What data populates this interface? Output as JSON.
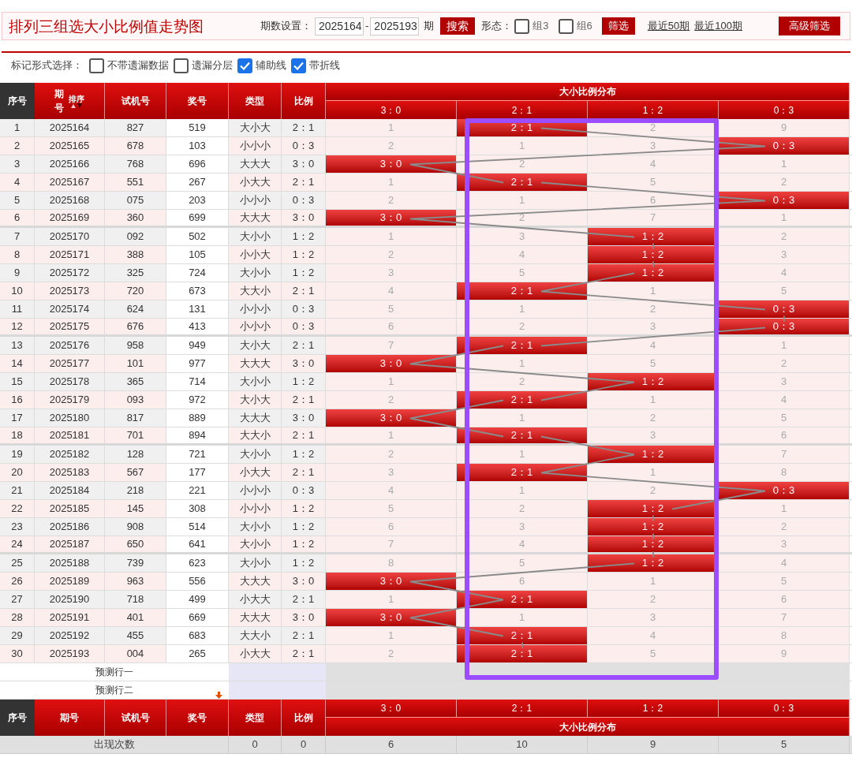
{
  "title": "排列三组选大小比例值走势图",
  "filter": {
    "period_label": "期数设置：",
    "start": "2025164",
    "dash": "-",
    "end": "2025193",
    "period_unit": "期",
    "search_button": "搜索",
    "form_label": "形态：",
    "forms": [
      {
        "label": "组3",
        "checked": false
      },
      {
        "label": "组6",
        "checked": false
      }
    ],
    "filter_button": "筛选",
    "links": [
      "最近50期",
      "最近100期"
    ],
    "advanced_button": "高级筛选"
  },
  "mark_options": {
    "label": "标记形式选择：",
    "options": [
      {
        "label": "不带遗漏数据",
        "checked": false
      },
      {
        "label": "遗漏分层",
        "checked": false
      },
      {
        "label": "辅助线",
        "checked": true
      },
      {
        "label": "带折线",
        "checked": true
      }
    ]
  },
  "table": {
    "columns": [
      "序号",
      "期号",
      "试机号",
      "奖号",
      "类型",
      "比例"
    ],
    "sort_label": "排序",
    "group_header": "大小比例分布",
    "sub_columns": [
      "3：0",
      "2：1",
      "1：2",
      "0：3"
    ],
    "rows": [
      {
        "no": "1",
        "issue": "2025164",
        "test": "827",
        "draw": "519",
        "type": "大小大",
        "ratio": "2：1",
        "dist": [
          {
            "text": "1",
            "hit": false
          },
          {
            "text": "2：1",
            "hit": true
          },
          {
            "text": "2",
            "hit": false
          },
          {
            "text": "9",
            "hit": false
          }
        ]
      },
      {
        "no": "2",
        "issue": "2025165",
        "test": "678",
        "draw": "103",
        "type": "小小小",
        "ratio": "0：3",
        "dist": [
          {
            "text": "2",
            "hit": false
          },
          {
            "text": "1",
            "hit": false
          },
          {
            "text": "3",
            "hit": false
          },
          {
            "text": "0：3",
            "hit": true
          }
        ]
      },
      {
        "no": "3",
        "issue": "2025166",
        "test": "768",
        "draw": "696",
        "type": "大大大",
        "ratio": "3：0",
        "dist": [
          {
            "text": "3：0",
            "hit": true
          },
          {
            "text": "2",
            "hit": false
          },
          {
            "text": "4",
            "hit": false
          },
          {
            "text": "1",
            "hit": false
          }
        ]
      },
      {
        "no": "4",
        "issue": "2025167",
        "test": "551",
        "draw": "267",
        "type": "小大大",
        "ratio": "2：1",
        "dist": [
          {
            "text": "1",
            "hit": false
          },
          {
            "text": "2：1",
            "hit": true
          },
          {
            "text": "5",
            "hit": false
          },
          {
            "text": "2",
            "hit": false
          }
        ]
      },
      {
        "no": "5",
        "issue": "2025168",
        "test": "075",
        "draw": "203",
        "type": "小小小",
        "ratio": "0：3",
        "dist": [
          {
            "text": "2",
            "hit": false
          },
          {
            "text": "1",
            "hit": false
          },
          {
            "text": "6",
            "hit": false
          },
          {
            "text": "0：3",
            "hit": true
          }
        ]
      },
      {
        "no": "6",
        "issue": "2025169",
        "test": "360",
        "draw": "699",
        "type": "大大大",
        "ratio": "3：0",
        "dist": [
          {
            "text": "3：0",
            "hit": true
          },
          {
            "text": "2",
            "hit": false
          },
          {
            "text": "7",
            "hit": false
          },
          {
            "text": "1",
            "hit": false
          }
        ]
      },
      {
        "no": "7",
        "issue": "2025170",
        "test": "092",
        "draw": "502",
        "type": "大小小",
        "ratio": "1：2",
        "dist": [
          {
            "text": "1",
            "hit": false
          },
          {
            "text": "3",
            "hit": false
          },
          {
            "text": "1：2",
            "hit": true
          },
          {
            "text": "2",
            "hit": false
          }
        ]
      },
      {
        "no": "8",
        "issue": "2025171",
        "test": "388",
        "draw": "105",
        "type": "小小大",
        "ratio": "1：2",
        "dist": [
          {
            "text": "2",
            "hit": false
          },
          {
            "text": "4",
            "hit": false
          },
          {
            "text": "1：2",
            "hit": true
          },
          {
            "text": "3",
            "hit": false
          }
        ]
      },
      {
        "no": "9",
        "issue": "2025172",
        "test": "325",
        "draw": "724",
        "type": "大小小",
        "ratio": "1：2",
        "dist": [
          {
            "text": "3",
            "hit": false
          },
          {
            "text": "5",
            "hit": false
          },
          {
            "text": "1：2",
            "hit": true
          },
          {
            "text": "4",
            "hit": false
          }
        ]
      },
      {
        "no": "10",
        "issue": "2025173",
        "test": "720",
        "draw": "673",
        "type": "大大小",
        "ratio": "2：1",
        "dist": [
          {
            "text": "4",
            "hit": false
          },
          {
            "text": "2：1",
            "hit": true
          },
          {
            "text": "1",
            "hit": false
          },
          {
            "text": "5",
            "hit": false
          }
        ]
      },
      {
        "no": "11",
        "issue": "2025174",
        "test": "624",
        "draw": "131",
        "type": "小小小",
        "ratio": "0：3",
        "dist": [
          {
            "text": "5",
            "hit": false
          },
          {
            "text": "1",
            "hit": false
          },
          {
            "text": "2",
            "hit": false
          },
          {
            "text": "0：3",
            "hit": true
          }
        ]
      },
      {
        "no": "12",
        "issue": "2025175",
        "test": "676",
        "draw": "413",
        "type": "小小小",
        "ratio": "0：3",
        "dist": [
          {
            "text": "6",
            "hit": false
          },
          {
            "text": "2",
            "hit": false
          },
          {
            "text": "3",
            "hit": false
          },
          {
            "text": "0：3",
            "hit": true
          }
        ]
      },
      {
        "no": "13",
        "issue": "2025176",
        "test": "958",
        "draw": "949",
        "type": "大小大",
        "ratio": "2：1",
        "dist": [
          {
            "text": "7",
            "hit": false
          },
          {
            "text": "2：1",
            "hit": true
          },
          {
            "text": "4",
            "hit": false
          },
          {
            "text": "1",
            "hit": false
          }
        ]
      },
      {
        "no": "14",
        "issue": "2025177",
        "test": "101",
        "draw": "977",
        "type": "大大大",
        "ratio": "3：0",
        "dist": [
          {
            "text": "3：0",
            "hit": true
          },
          {
            "text": "1",
            "hit": false
          },
          {
            "text": "5",
            "hit": false
          },
          {
            "text": "2",
            "hit": false
          }
        ]
      },
      {
        "no": "15",
        "issue": "2025178",
        "test": "365",
        "draw": "714",
        "type": "大小小",
        "ratio": "1：2",
        "dist": [
          {
            "text": "1",
            "hit": false
          },
          {
            "text": "2",
            "hit": false
          },
          {
            "text": "1：2",
            "hit": true
          },
          {
            "text": "3",
            "hit": false
          }
        ]
      },
      {
        "no": "16",
        "issue": "2025179",
        "test": "093",
        "draw": "972",
        "type": "大小大",
        "ratio": "2：1",
        "dist": [
          {
            "text": "2",
            "hit": false
          },
          {
            "text": "2：1",
            "hit": true
          },
          {
            "text": "1",
            "hit": false
          },
          {
            "text": "4",
            "hit": false
          }
        ]
      },
      {
        "no": "17",
        "issue": "2025180",
        "test": "817",
        "draw": "889",
        "type": "大大大",
        "ratio": "3：0",
        "dist": [
          {
            "text": "3：0",
            "hit": true
          },
          {
            "text": "1",
            "hit": false
          },
          {
            "text": "2",
            "hit": false
          },
          {
            "text": "5",
            "hit": false
          }
        ]
      },
      {
        "no": "18",
        "issue": "2025181",
        "test": "701",
        "draw": "894",
        "type": "大大小",
        "ratio": "2：1",
        "dist": [
          {
            "text": "1",
            "hit": false
          },
          {
            "text": "2：1",
            "hit": true
          },
          {
            "text": "3",
            "hit": false
          },
          {
            "text": "6",
            "hit": false
          }
        ]
      },
      {
        "no": "19",
        "issue": "2025182",
        "test": "128",
        "draw": "721",
        "type": "大小小",
        "ratio": "1：2",
        "dist": [
          {
            "text": "2",
            "hit": false
          },
          {
            "text": "1",
            "hit": false
          },
          {
            "text": "1：2",
            "hit": true
          },
          {
            "text": "7",
            "hit": false
          }
        ]
      },
      {
        "no": "20",
        "issue": "2025183",
        "test": "567",
        "draw": "177",
        "type": "小大大",
        "ratio": "2：1",
        "dist": [
          {
            "text": "3",
            "hit": false
          },
          {
            "text": "2：1",
            "hit": true
          },
          {
            "text": "1",
            "hit": false
          },
          {
            "text": "8",
            "hit": false
          }
        ]
      },
      {
        "no": "21",
        "issue": "2025184",
        "test": "218",
        "draw": "221",
        "type": "小小小",
        "ratio": "0：3",
        "dist": [
          {
            "text": "4",
            "hit": false
          },
          {
            "text": "1",
            "hit": false
          },
          {
            "text": "2",
            "hit": false
          },
          {
            "text": "0：3",
            "hit": true
          }
        ]
      },
      {
        "no": "22",
        "issue": "2025185",
        "test": "145",
        "draw": "308",
        "type": "小小小",
        "ratio": "1：2",
        "dist": [
          {
            "text": "5",
            "hit": false
          },
          {
            "text": "2",
            "hit": false
          },
          {
            "text": "1：2",
            "hit": true
          },
          {
            "text": "1",
            "hit": false
          }
        ]
      },
      {
        "no": "23",
        "issue": "2025186",
        "test": "908",
        "draw": "514",
        "type": "大小小",
        "ratio": "1：2",
        "dist": [
          {
            "text": "6",
            "hit": false
          },
          {
            "text": "3",
            "hit": false
          },
          {
            "text": "1：2",
            "hit": true
          },
          {
            "text": "2",
            "hit": false
          }
        ]
      },
      {
        "no": "24",
        "issue": "2025187",
        "test": "650",
        "draw": "641",
        "type": "大小小",
        "ratio": "1：2",
        "dist": [
          {
            "text": "7",
            "hit": false
          },
          {
            "text": "4",
            "hit": false
          },
          {
            "text": "1：2",
            "hit": true
          },
          {
            "text": "3",
            "hit": false
          }
        ]
      },
      {
        "no": "25",
        "issue": "2025188",
        "test": "739",
        "draw": "623",
        "type": "大小小",
        "ratio": "1：2",
        "dist": [
          {
            "text": "8",
            "hit": false
          },
          {
            "text": "5",
            "hit": false
          },
          {
            "text": "1：2",
            "hit": true
          },
          {
            "text": "4",
            "hit": false
          }
        ]
      },
      {
        "no": "26",
        "issue": "2025189",
        "test": "963",
        "draw": "556",
        "type": "大大大",
        "ratio": "3：0",
        "dist": [
          {
            "text": "3：0",
            "hit": true
          },
          {
            "text": "6",
            "hit": false
          },
          {
            "text": "1",
            "hit": false
          },
          {
            "text": "5",
            "hit": false
          }
        ]
      },
      {
        "no": "27",
        "issue": "2025190",
        "test": "718",
        "draw": "499",
        "type": "小大大",
        "ratio": "2：1",
        "dist": [
          {
            "text": "1",
            "hit": false
          },
          {
            "text": "2：1",
            "hit": true
          },
          {
            "text": "2",
            "hit": false
          },
          {
            "text": "6",
            "hit": false
          }
        ]
      },
      {
        "no": "28",
        "issue": "2025191",
        "test": "401",
        "draw": "669",
        "type": "大大大",
        "ratio": "3：0",
        "dist": [
          {
            "text": "3：0",
            "hit": true
          },
          {
            "text": "1",
            "hit": false
          },
          {
            "text": "3",
            "hit": false
          },
          {
            "text": "7",
            "hit": false
          }
        ]
      },
      {
        "no": "29",
        "issue": "2025192",
        "test": "455",
        "draw": "683",
        "type": "大大小",
        "ratio": "2：1",
        "dist": [
          {
            "text": "1",
            "hit": false
          },
          {
            "text": "2：1",
            "hit": true
          },
          {
            "text": "4",
            "hit": false
          },
          {
            "text": "8",
            "hit": false
          }
        ]
      },
      {
        "no": "30",
        "issue": "2025193",
        "test": "004",
        "draw": "265",
        "type": "小大大",
        "ratio": "2：1",
        "dist": [
          {
            "text": "2",
            "hit": false
          },
          {
            "text": "2：1",
            "hit": true
          },
          {
            "text": "5",
            "hit": false
          },
          {
            "text": "9",
            "hit": false
          }
        ]
      }
    ],
    "prediction_rows": [
      "预测行一",
      "预测行二"
    ],
    "footer_columns": [
      "序号",
      "期号",
      "试机号",
      "奖号",
      "类型",
      "比例"
    ],
    "footer_sub_columns": [
      "3：0",
      "2：1",
      "1：2",
      "0：3"
    ],
    "footer_group_header": "大小比例分布",
    "summary": {
      "label": "出现次数",
      "values": [
        "0",
        "0",
        "6",
        "10",
        "9",
        "5"
      ]
    }
  }
}
